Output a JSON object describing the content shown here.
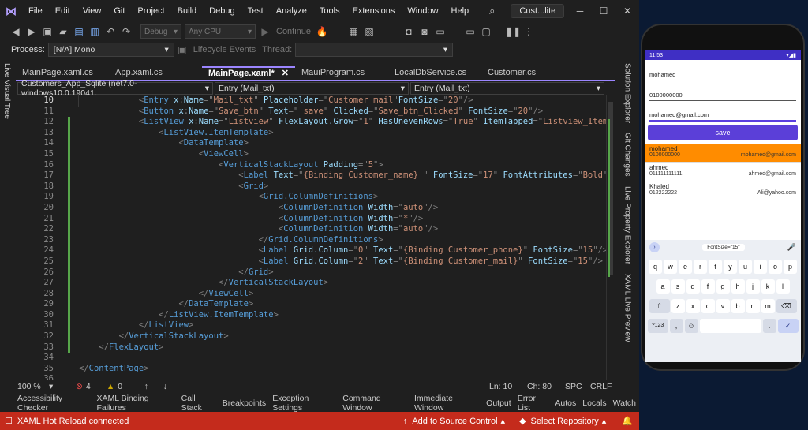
{
  "menubar": {
    "items": [
      "File",
      "Edit",
      "View",
      "Git",
      "Project",
      "Build",
      "Debug",
      "Test",
      "Analyze",
      "Tools",
      "Extensions",
      "Window",
      "Help"
    ],
    "title": "Cust...lite"
  },
  "toolbar": {
    "config": "Debug",
    "platform": "Any CPU",
    "continue_label": "Continue"
  },
  "processbar": {
    "process_label": "Process:",
    "process_value": "[N/A] Mono",
    "lifecycle_label": "Lifecycle Events",
    "thread_label": "Thread:"
  },
  "left_rail": "Live Visual Tree",
  "right_rail": [
    "Solution Explorer",
    "Git Changes",
    "Live Property Explorer",
    "XAML Live Preview"
  ],
  "tabs": [
    {
      "label": "MainPage.xaml.cs",
      "active": false
    },
    {
      "label": "App.xaml.cs",
      "active": false
    },
    {
      "label": "MainPage.xaml*",
      "active": true
    },
    {
      "label": "MauiProgram.cs",
      "active": false
    },
    {
      "label": "LocalDbService.cs",
      "active": false
    },
    {
      "label": "Customer.cs",
      "active": false
    }
  ],
  "navbar": {
    "project": "Customers_App_Sqlite (net7.0-windows10.0.19041.",
    "element1": "Entry (Mail_txt)",
    "element2": "Entry (Mail_txt)"
  },
  "code_lines": [
    {
      "n": "10",
      "indent": "            ",
      "seg": [
        [
          "p",
          "<"
        ],
        [
          "t",
          "Entry "
        ],
        [
          "a",
          "x"
        ],
        [
          "p",
          ":"
        ],
        [
          "a",
          "Name"
        ],
        [
          "p",
          "=\""
        ],
        [
          "v",
          "Mail_txt"
        ],
        [
          "p",
          "\" "
        ],
        [
          "a",
          "Placeholder"
        ],
        [
          "p",
          "=\""
        ],
        [
          "v",
          "Customer mail"
        ],
        [
          "p",
          "\""
        ],
        [
          "a",
          "FontSize"
        ],
        [
          "p",
          "=\""
        ],
        [
          "v",
          "20"
        ],
        [
          "p",
          "\"/>"
        ]
      ]
    },
    {
      "n": "11",
      "indent": "            ",
      "seg": [
        [
          "p",
          "<"
        ],
        [
          "t",
          "Button "
        ],
        [
          "a",
          "x"
        ],
        [
          "p",
          ":"
        ],
        [
          "a",
          "Name"
        ],
        [
          "p",
          "=\""
        ],
        [
          "v",
          "Save_btn"
        ],
        [
          "p",
          "\" "
        ],
        [
          "a",
          "Text"
        ],
        [
          "p",
          "=\""
        ],
        [
          "v",
          " save"
        ],
        [
          "p",
          "\" "
        ],
        [
          "a",
          "Clicked"
        ],
        [
          "p",
          "=\""
        ],
        [
          "v",
          "Save_btn_Clicked"
        ],
        [
          "p",
          "\" "
        ],
        [
          "a",
          "FontSize"
        ],
        [
          "p",
          "=\""
        ],
        [
          "v",
          "20"
        ],
        [
          "p",
          "\"/>"
        ]
      ]
    },
    {
      "n": "12",
      "indent": "            ",
      "seg": [
        [
          "p",
          "<"
        ],
        [
          "t",
          "ListView "
        ],
        [
          "a",
          "x"
        ],
        [
          "p",
          ":"
        ],
        [
          "a",
          "Name"
        ],
        [
          "p",
          "=\""
        ],
        [
          "v",
          "Listview"
        ],
        [
          "p",
          "\" "
        ],
        [
          "a",
          "FlexLayout.Grow"
        ],
        [
          "p",
          "=\""
        ],
        [
          "v",
          "1"
        ],
        [
          "p",
          "\" "
        ],
        [
          "a",
          "HasUnevenRows"
        ],
        [
          "p",
          "=\""
        ],
        [
          "v",
          "True"
        ],
        [
          "p",
          "\" "
        ],
        [
          "a",
          "ItemTapped"
        ],
        [
          "p",
          "=\""
        ],
        [
          "v",
          "Listview_ItemTapp"
        ]
      ]
    },
    {
      "n": "13",
      "indent": "                ",
      "seg": [
        [
          "p",
          "<"
        ],
        [
          "t",
          "ListView.ItemTemplate"
        ],
        [
          "p",
          ">"
        ]
      ]
    },
    {
      "n": "14",
      "indent": "                    ",
      "seg": [
        [
          "p",
          "<"
        ],
        [
          "t",
          "DataTemplate"
        ],
        [
          "p",
          ">"
        ]
      ]
    },
    {
      "n": "15",
      "indent": "                        ",
      "seg": [
        [
          "p",
          "<"
        ],
        [
          "t",
          "ViewCell"
        ],
        [
          "p",
          ">"
        ]
      ]
    },
    {
      "n": "16",
      "indent": "                            ",
      "seg": [
        [
          "p",
          "<"
        ],
        [
          "t",
          "VerticalStackLayout "
        ],
        [
          "a",
          "Padding"
        ],
        [
          "p",
          "=\""
        ],
        [
          "v",
          "5"
        ],
        [
          "p",
          "\">"
        ]
      ]
    },
    {
      "n": "17",
      "indent": "                                ",
      "seg": [
        [
          "p",
          "<"
        ],
        [
          "t",
          "Label "
        ],
        [
          "a",
          "Text"
        ],
        [
          "p",
          "=\""
        ],
        [
          "v",
          "{Binding Customer_name} "
        ],
        [
          "p",
          "\" "
        ],
        [
          "a",
          "FontSize"
        ],
        [
          "p",
          "=\""
        ],
        [
          "v",
          "17"
        ],
        [
          "p",
          "\" "
        ],
        [
          "a",
          "FontAttributes"
        ],
        [
          "p",
          "=\""
        ],
        [
          "v",
          "Bold"
        ],
        [
          "p",
          "\"/>"
        ]
      ]
    },
    {
      "n": "18",
      "indent": "                                ",
      "seg": [
        [
          "p",
          "<"
        ],
        [
          "t",
          "Grid"
        ],
        [
          "p",
          ">"
        ]
      ]
    },
    {
      "n": "19",
      "indent": "                                    ",
      "seg": [
        [
          "p",
          "<"
        ],
        [
          "t",
          "Grid.ColumnDefinitions"
        ],
        [
          "p",
          ">"
        ]
      ]
    },
    {
      "n": "20",
      "indent": "                                        ",
      "seg": [
        [
          "p",
          "<"
        ],
        [
          "t",
          "ColumnDefinition "
        ],
        [
          "a",
          "Width"
        ],
        [
          "p",
          "=\""
        ],
        [
          "v",
          "auto"
        ],
        [
          "p",
          "\"/>"
        ]
      ]
    },
    {
      "n": "21",
      "indent": "                                        ",
      "seg": [
        [
          "p",
          "<"
        ],
        [
          "t",
          "ColumnDefinition "
        ],
        [
          "a",
          "Width"
        ],
        [
          "p",
          "=\""
        ],
        [
          "v",
          "*"
        ],
        [
          "p",
          "\"/>"
        ]
      ]
    },
    {
      "n": "22",
      "indent": "                                        ",
      "seg": [
        [
          "p",
          "<"
        ],
        [
          "t",
          "ColumnDefinition "
        ],
        [
          "a",
          "Width"
        ],
        [
          "p",
          "=\""
        ],
        [
          "v",
          "auto"
        ],
        [
          "p",
          "\"/>"
        ]
      ]
    },
    {
      "n": "23",
      "indent": "                                    ",
      "seg": [
        [
          "p",
          "</"
        ],
        [
          "t",
          "Grid.ColumnDefinitions"
        ],
        [
          "p",
          ">"
        ]
      ]
    },
    {
      "n": "24",
      "indent": "                                    ",
      "seg": [
        [
          "p",
          "<"
        ],
        [
          "t",
          "Label "
        ],
        [
          "a",
          "Grid.Column"
        ],
        [
          "p",
          "=\""
        ],
        [
          "v",
          "0"
        ],
        [
          "p",
          "\" "
        ],
        [
          "a",
          "Text"
        ],
        [
          "p",
          "=\""
        ],
        [
          "v",
          "{Binding Customer_phone}"
        ],
        [
          "p",
          "\" "
        ],
        [
          "a",
          "FontSize"
        ],
        [
          "p",
          "=\""
        ],
        [
          "v",
          "15"
        ],
        [
          "p",
          "\"/>"
        ]
      ]
    },
    {
      "n": "25",
      "indent": "                                    ",
      "seg": [
        [
          "p",
          "<"
        ],
        [
          "t",
          "Label "
        ],
        [
          "a",
          "Grid.Column"
        ],
        [
          "p",
          "=\""
        ],
        [
          "v",
          "2"
        ],
        [
          "p",
          "\" "
        ],
        [
          "a",
          "Text"
        ],
        [
          "p",
          "=\""
        ],
        [
          "v",
          "{Binding Customer_mail}"
        ],
        [
          "p",
          "\" "
        ],
        [
          "a",
          "FontSize"
        ],
        [
          "p",
          "=\""
        ],
        [
          "v",
          "15"
        ],
        [
          "p",
          "\"/>"
        ]
      ]
    },
    {
      "n": "26",
      "indent": "                                ",
      "seg": [
        [
          "p",
          "</"
        ],
        [
          "t",
          "Grid"
        ],
        [
          "p",
          ">"
        ]
      ]
    },
    {
      "n": "27",
      "indent": "                            ",
      "seg": [
        [
          "p",
          "</"
        ],
        [
          "t",
          "VerticalStackLayout"
        ],
        [
          "p",
          ">"
        ]
      ]
    },
    {
      "n": "28",
      "indent": "                        ",
      "seg": [
        [
          "p",
          "</"
        ],
        [
          "t",
          "ViewCell"
        ],
        [
          "p",
          ">"
        ]
      ]
    },
    {
      "n": "29",
      "indent": "                    ",
      "seg": [
        [
          "p",
          "</"
        ],
        [
          "t",
          "DataTemplate"
        ],
        [
          "p",
          ">"
        ]
      ]
    },
    {
      "n": "30",
      "indent": "                ",
      "seg": [
        [
          "p",
          "</"
        ],
        [
          "t",
          "ListView.ItemTemplate"
        ],
        [
          "p",
          ">"
        ]
      ]
    },
    {
      "n": "31",
      "indent": "            ",
      "seg": [
        [
          "p",
          "</"
        ],
        [
          "t",
          "ListView"
        ],
        [
          "p",
          ">"
        ]
      ]
    },
    {
      "n": "32",
      "indent": "        ",
      "seg": [
        [
          "p",
          "</"
        ],
        [
          "t",
          "VerticalStackLayout"
        ],
        [
          "p",
          ">"
        ]
      ]
    },
    {
      "n": "33",
      "indent": "    ",
      "seg": [
        [
          "p",
          "</"
        ],
        [
          "t",
          "FlexLayout"
        ],
        [
          "p",
          ">"
        ]
      ]
    },
    {
      "n": "34",
      "indent": "",
      "seg": []
    },
    {
      "n": "35",
      "indent": "",
      "seg": [
        [
          "p",
          "</"
        ],
        [
          "t",
          "ContentPage"
        ],
        [
          "p",
          ">"
        ]
      ]
    },
    {
      "n": "36",
      "indent": "",
      "seg": []
    }
  ],
  "editor_status": {
    "zoom": "100 %",
    "errors": "4",
    "warnings": "0",
    "line": "Ln: 10",
    "col": "Ch: 80",
    "spc": "SPC",
    "eol": "CRLF"
  },
  "tool_windows": [
    "Accessibility Checker",
    "XAML Binding Failures",
    "Call Stack",
    "Breakpoints",
    "Exception Settings",
    "Command Window",
    "Immediate Window",
    "Output",
    "Error List",
    "Autos",
    "Locals",
    "Watch"
  ],
  "statusbar": {
    "hot_reload": "XAML Hot Reload connected",
    "source_control": "Add to Source Control",
    "repository": "Select Repository"
  },
  "phone": {
    "time": "11:53",
    "entries": [
      "mohamed",
      "0100000000",
      "mohamed@gmail.com"
    ],
    "save_label": "save",
    "customers": [
      {
        "name": "mohamed",
        "phone": "0100000000",
        "mail": "mohamed@gmail.com",
        "selected": true
      },
      {
        "name": "ahmed",
        "phone": "011111111111",
        "mail": "ahmed@gmail.com",
        "selected": false
      },
      {
        "name": "Khaled",
        "phone": "012222222",
        "mail": "Ali@yahoo.com",
        "selected": false
      }
    ],
    "suggestion": "FontSize=\"15\"",
    "keys_row1": [
      "q",
      "w",
      "e",
      "r",
      "t",
      "y",
      "u",
      "i",
      "o",
      "p"
    ],
    "keys_row2": [
      "a",
      "s",
      "d",
      "f",
      "g",
      "h",
      "j",
      "k",
      "l"
    ],
    "keys_row3": [
      "z",
      "x",
      "c",
      "v",
      "b",
      "n",
      "m"
    ],
    "key_symbols": "?123",
    "key_comma": ",",
    "key_period": "."
  },
  "colors": {
    "accent": "#9b85ff",
    "status_bar": "#c42b1c",
    "phone_accent": "#5b3fd8",
    "selected_row": "#ff8c00"
  }
}
